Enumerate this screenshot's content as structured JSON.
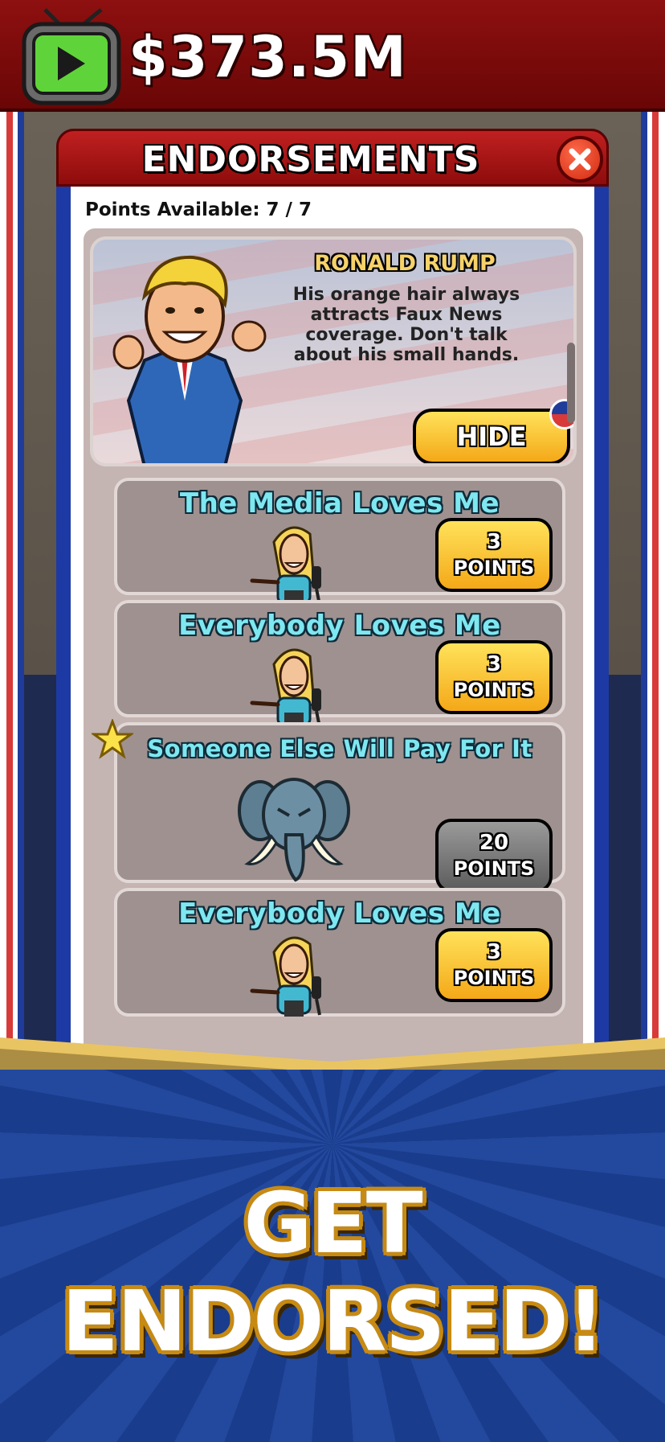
{
  "header": {
    "money": "$373.5M"
  },
  "dialog": {
    "title": "ENDORSEMENTS",
    "points_available": "Points Available: 7 / 7"
  },
  "selected": {
    "name": "RONALD RUMP",
    "description": "His orange hair always attracts Faux News coverage. Don't talk about his small hands.",
    "button_label": "HIDE"
  },
  "endorsements": [
    {
      "title": "The Media Loves Me",
      "points": "3",
      "points_label": "POINTS",
      "available": true,
      "icon": "reporter-icon"
    },
    {
      "title": "Everybody Loves Me",
      "points": "3",
      "points_label": "POINTS",
      "available": true,
      "icon": "reporter-icon"
    },
    {
      "title": "Someone Else Will Pay For It",
      "points": "20",
      "points_label": "POINTS",
      "available": false,
      "icon": "elephant-icon",
      "starred": true
    },
    {
      "title": "Everybody Loves Me",
      "points": "3",
      "points_label": "POINTS",
      "available": true,
      "icon": "reporter-icon"
    }
  ],
  "banner": {
    "text": "GET ENDORSED!"
  },
  "colors": {
    "top_bar": "#8e1010",
    "dialog_frame": "#1d3aa4",
    "card_title": "#7ee7f0",
    "button_yellow": "#f4a818",
    "button_gray": "#5d5d5d",
    "banner_blue": "#1a3c8c",
    "banner_gold": "#c78a12"
  }
}
